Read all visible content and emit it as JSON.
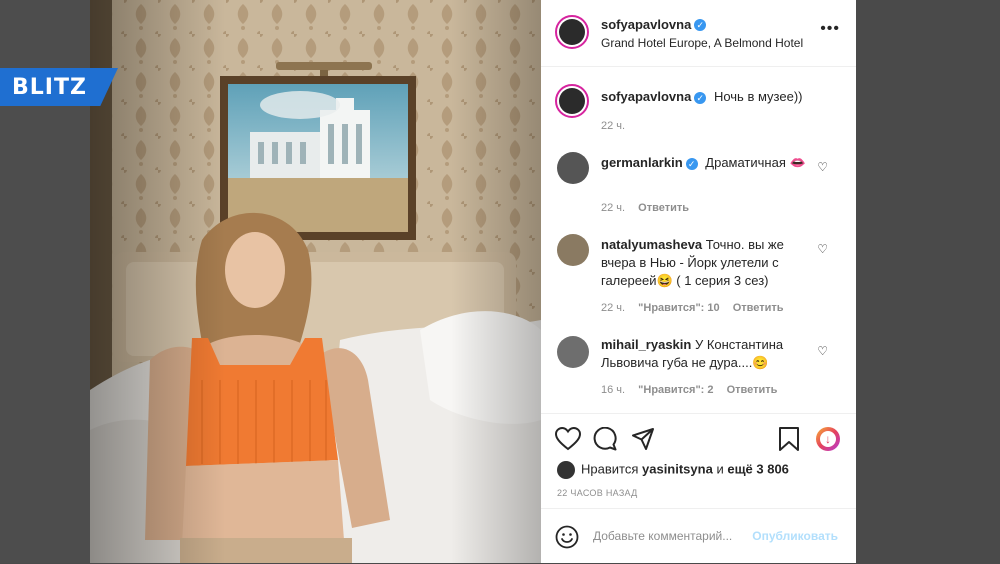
{
  "brand": {
    "logo_text": "BLITZ",
    "color": "#1f6fd1"
  },
  "post": {
    "author": "sofyapavlovna",
    "location": "Grand Hotel Europe, A Belmond Hotel",
    "more_icon": "•••"
  },
  "caption": {
    "author": "sofyapavlovna",
    "text": "Ночь в музее))",
    "time": "22 ч."
  },
  "comments": [
    {
      "user": "germanlarkin",
      "verified": true,
      "text": "Драматичная 👄",
      "time": "22 ч.",
      "likes": "",
      "reply": "Ответить"
    },
    {
      "user": "natalyumasheva",
      "verified": false,
      "text": "Точно. вы же вчера в Нью - Йорк улетели с галереей😆 ( 1 серия 3 сез)",
      "time": "22 ч.",
      "likes": "\"Нравится\": 10",
      "reply": "Ответить"
    },
    {
      "user": "mihail_ryaskin",
      "verified": false,
      "text": "У Константина Львовича губа не дура....😊",
      "time": "16 ч.",
      "likes": "\"Нравится\": 2",
      "reply": "Ответить"
    }
  ],
  "likes": {
    "prefix": "Нравится",
    "user": "yasinitsyna",
    "connector": "и",
    "rest": "ещё 3 806"
  },
  "time_ago": "22 ЧАСОВ НАЗАД",
  "comment_box": {
    "placeholder": "Добавьте комментарий...",
    "publish": "Опубликовать"
  },
  "colors": {
    "accent": "#3897f0",
    "text": "#262626",
    "muted": "#8e8e8e",
    "publish_disabled": "#b2dffc"
  }
}
